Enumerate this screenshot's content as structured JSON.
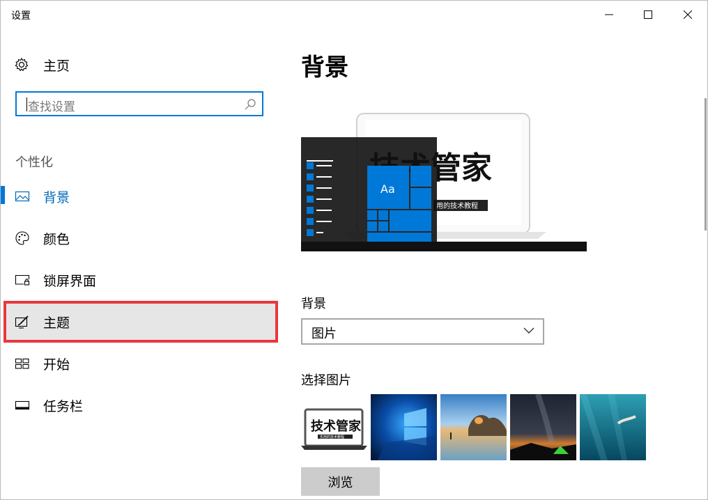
{
  "window": {
    "title": "设置"
  },
  "nav": {
    "home_label": "主页",
    "search_placeholder": "查找设置",
    "section_title": "个性化",
    "items": [
      {
        "label": "背景",
        "icon": "picture-icon",
        "active": true
      },
      {
        "label": "颜色",
        "icon": "palette-icon"
      },
      {
        "label": "锁屏界面",
        "icon": "lock-screen-icon"
      },
      {
        "label": "主题",
        "icon": "theme-brush-icon",
        "highlighted": true
      },
      {
        "label": "开始",
        "icon": "start-grid-icon"
      },
      {
        "label": "任务栏",
        "icon": "taskbar-icon"
      }
    ]
  },
  "main": {
    "title": "背景",
    "preview": {
      "tile_text": "Aa",
      "wallpaper_text": "技术管家",
      "wallpaper_subtext": "用的技术教程"
    },
    "background_label": "背景",
    "background_value": "图片",
    "choose_label": "选择图片",
    "thumbnails": [
      {
        "name": "技术管家",
        "caption": "实用的技术教程"
      },
      {
        "name": "windows-blue"
      },
      {
        "name": "beach-rocks"
      },
      {
        "name": "night-sky-tent"
      },
      {
        "name": "underwater-swimmer"
      }
    ],
    "browse_label": "浏览"
  },
  "colors": {
    "accent": "#0078d7",
    "highlight_border": "#e8383d",
    "tile": "#0078d7"
  }
}
